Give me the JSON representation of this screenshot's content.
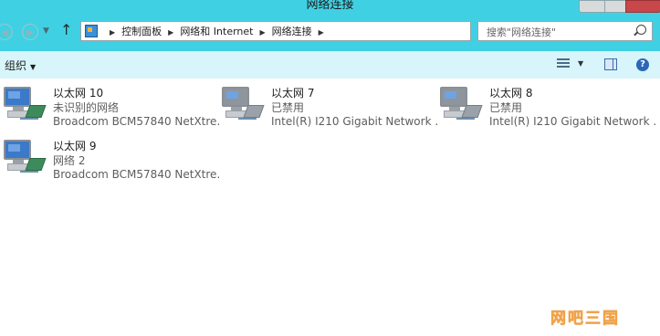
{
  "window": {
    "title": "网络连接"
  },
  "navigation": {
    "breadcrumbs": [
      "控制面板",
      "网络和 Internet",
      "网络连接"
    ],
    "search_placeholder": "搜索\"网络连接\""
  },
  "toolbar": {
    "organize_label": "组织",
    "icons": [
      "change-view-icon",
      "preview-pane-icon",
      "help-icon"
    ]
  },
  "connections": [
    {
      "name": "以太网 10",
      "status": "未识别的网络",
      "adapter": "Broadcom BCM57840 NetXtre...",
      "state": "enabled"
    },
    {
      "name": "以太网 7",
      "status": "已禁用",
      "adapter": "Intel(R) I210 Gigabit Network ...",
      "state": "disabled"
    },
    {
      "name": "以太网 8",
      "status": "已禁用",
      "adapter": "Intel(R) I210 Gigabit Network ...",
      "state": "disabled"
    },
    {
      "name": "以太网 9",
      "status": "网络  2",
      "adapter": "Broadcom BCM57840 NetXtre...",
      "state": "enabled"
    }
  ],
  "watermark": "网吧三国",
  "colors": {
    "titlebar": "#3fd1e3",
    "commandbar": "#d7f5fa",
    "close_button": "#c7474a"
  }
}
